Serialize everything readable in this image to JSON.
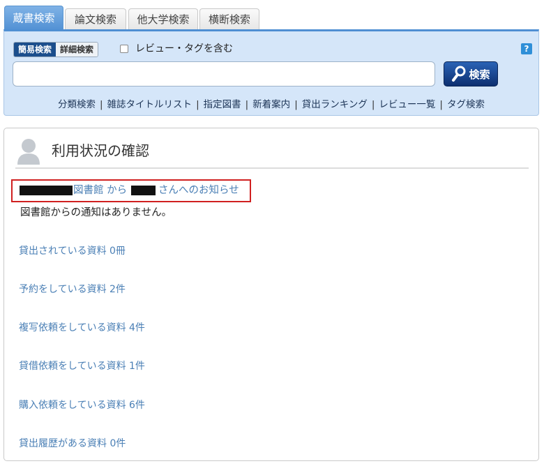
{
  "tabs": [
    {
      "label": "蔵書検索",
      "active": true
    },
    {
      "label": "論文検索",
      "active": false
    },
    {
      "label": "他大学検索",
      "active": false
    },
    {
      "label": "横断検索",
      "active": false
    }
  ],
  "search": {
    "mode_simple": "簡易検索",
    "mode_detail": "詳細検索",
    "include_reviews_label": "レビュー・タグを含む",
    "include_reviews_checked": false,
    "query_value": "",
    "button_label": "検索",
    "help_icon": "?"
  },
  "quick_links": [
    "分類検索",
    "雑誌タイトルリスト",
    "指定図書",
    "新着案内",
    "貸出ランキング",
    "レビュー一覧",
    "タグ検索"
  ],
  "panel": {
    "title": "利用状況の確認",
    "notice_library_suffix": "図書館 から",
    "notice_user_suffix": "さんへのお知らせ",
    "no_notice_text": "図書館からの通知はありません。",
    "items": [
      "貸出されている資料 0冊",
      "予約をしている資料 2件",
      "複写依頼をしている資料 4件",
      "貸借依頼をしている資料 1件",
      "購入依頼をしている資料 6件",
      "貸出履歴がある資料 0件"
    ]
  },
  "colors": {
    "tab_active": "#4f8fd3",
    "search_bg": "#d5e6f9",
    "search_button": "#0d2f70",
    "link": "#4a7fb5",
    "highlight_border": "#d02020"
  }
}
